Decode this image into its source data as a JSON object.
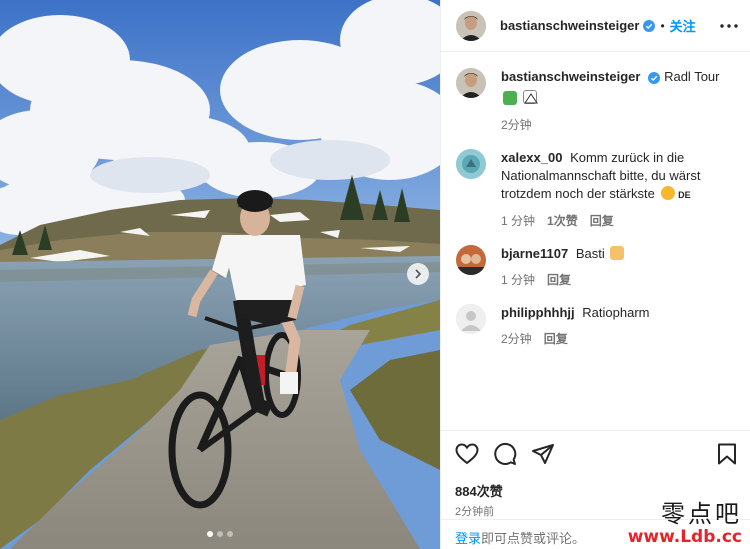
{
  "photo": {
    "alt": "post-photo",
    "slide_count": 3,
    "active_slide": 1
  },
  "header": {
    "username": "bastianschweinsteiger",
    "separator": "•",
    "follow_label": "关注"
  },
  "caption": {
    "username": "bastianschweinsteiger",
    "text": "Radl Tour",
    "time": "2分钟"
  },
  "comments": [
    {
      "username": "xalexx_00",
      "text": "Komm zurück in die Nationalmannschaft bitte, du wärst trotzdem noch der stärkste",
      "suffix": "DE",
      "time": "1 分钟",
      "likes": "1次赞",
      "reply": "回复"
    },
    {
      "username": "bjarne1107",
      "text": "Basti",
      "time": "1 分钟",
      "reply": "回复"
    },
    {
      "username": "philipphhhjj",
      "text": "Ratiopharm",
      "time": "2分钟",
      "reply": "回复"
    }
  ],
  "actions": {
    "likes": "884次赞",
    "time": "2分钟前"
  },
  "login": {
    "link": "登录",
    "rest": "即可点赞或评论。"
  },
  "watermark": {
    "cn": "零点吧",
    "url": "www.Ldb.cc"
  },
  "colors": {
    "accent": "#0095f6",
    "verified": "#3897f0",
    "watermark_url": "#e5232a"
  }
}
